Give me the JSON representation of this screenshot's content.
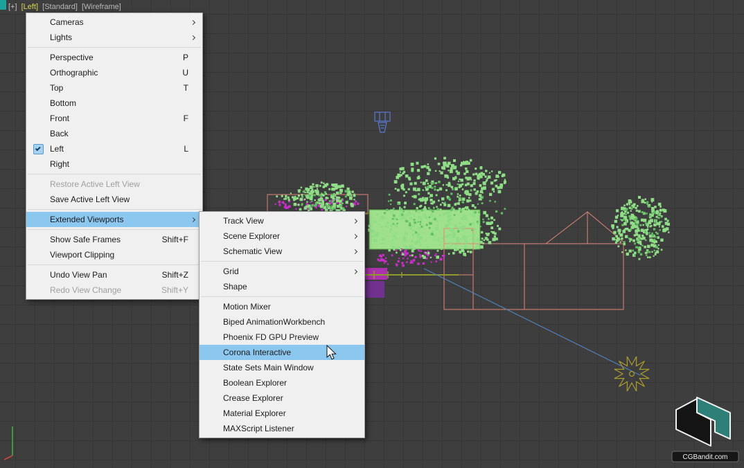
{
  "viewport": {
    "labels": {
      "plus": "[+]",
      "view": "[Left]",
      "style": "[Standard]",
      "shading": "[Wireframe]"
    }
  },
  "context_menu": {
    "items": [
      {
        "label": "Cameras",
        "submenu": true
      },
      {
        "label": "Lights",
        "submenu": true
      },
      {
        "separator": true
      },
      {
        "label": "Perspective",
        "shortcut": "P"
      },
      {
        "label": "Orthographic",
        "shortcut": "U"
      },
      {
        "label": "Top",
        "shortcut": "T"
      },
      {
        "label": "Bottom"
      },
      {
        "label": "Front",
        "shortcut": "F"
      },
      {
        "label": "Back"
      },
      {
        "label": "Left",
        "shortcut": "L",
        "checked": true
      },
      {
        "label": "Right"
      },
      {
        "separator": true
      },
      {
        "label": "Restore Active Left View",
        "disabled": true
      },
      {
        "label": "Save Active Left View"
      },
      {
        "separator": true
      },
      {
        "label": "Extended Viewports",
        "submenu": true,
        "highlighted": true
      },
      {
        "separator": true
      },
      {
        "label": "Show Safe Frames",
        "shortcut": "Shift+F"
      },
      {
        "label": "Viewport Clipping"
      },
      {
        "separator": true
      },
      {
        "label": "Undo View Pan",
        "shortcut": "Shift+Z"
      },
      {
        "label": "Redo View Change",
        "shortcut": "Shift+Y",
        "disabled": true
      }
    ]
  },
  "submenu": {
    "items": [
      {
        "label": "Track View",
        "submenu": true
      },
      {
        "label": "Scene Explorer",
        "submenu": true
      },
      {
        "label": "Schematic View",
        "submenu": true
      },
      {
        "separator": true
      },
      {
        "label": "Grid",
        "submenu": true
      },
      {
        "label": "Shape"
      },
      {
        "separator": true
      },
      {
        "label": "Motion Mixer"
      },
      {
        "label": "Biped AnimationWorkbench"
      },
      {
        "label": "Phoenix FD GPU Preview"
      },
      {
        "label": "Corona Interactive",
        "highlighted": true
      },
      {
        "label": "State Sets Main Window"
      },
      {
        "label": "Boolean Explorer"
      },
      {
        "label": "Crease Explorer"
      },
      {
        "label": "Material Explorer"
      },
      {
        "label": "MAXScript Listener"
      }
    ]
  },
  "logo": {
    "text": "CGBandit.com"
  },
  "colors": {
    "viewport_bg": "#3e3e3e",
    "grid_line": "#363636",
    "menu_bg": "#f0f0f0",
    "menu_highlight": "#8cc7f0",
    "menu_text": "#1b1b1b",
    "menu_disabled": "#9f9f9f",
    "label_yellow": "#d6d64e",
    "tree_green": "#8fdd87",
    "tree_green_dark": "#5fbf62",
    "hedge_fill": "#9fe08c",
    "hedge_stroke": "#4f9a42",
    "house_outline": "#e08878",
    "magenta": "#c92fc9",
    "purple": "#7a2f9e",
    "olive": "#8f9a2e",
    "sun": "#ab9c30",
    "camera_blue": "#5b7bd0",
    "line_blue": "#4f7fb5",
    "logo_teal": "#2e7f78"
  }
}
